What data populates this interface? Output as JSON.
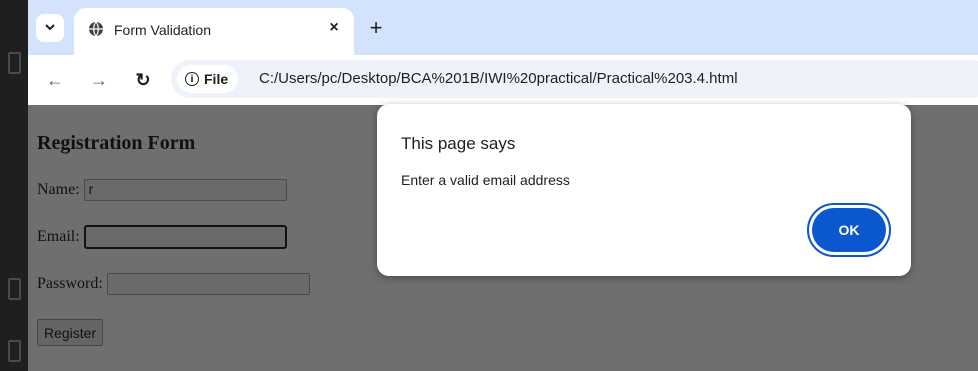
{
  "browser": {
    "tab": {
      "title": "Form Validation",
      "close_glyph": "×",
      "favicon": "globe-icon"
    },
    "new_tab_glyph": "+",
    "tab_search_glyph": "⌄",
    "toolbar": {
      "back_glyph": "←",
      "forward_glyph": "→",
      "reload_glyph": "↻",
      "site_chip_label": "File",
      "url": "C:/Users/pc/Desktop/BCA%201B/IWI%20practical/Practical%203.4.html"
    }
  },
  "page": {
    "heading": "Registration Form",
    "fields": {
      "name_label": "Name:",
      "name_value": "r",
      "email_label": "Email:",
      "email_value": "",
      "password_label": "Password:",
      "password_value": ""
    },
    "register_label": "Register"
  },
  "dialog": {
    "title": "This page says",
    "message": "Enter a valid email address",
    "ok_label": "OK"
  },
  "colors": {
    "tabstrip": "#d3e3fd",
    "accent": "#0b57d0",
    "page_dimmed": "#6f6f6f"
  }
}
